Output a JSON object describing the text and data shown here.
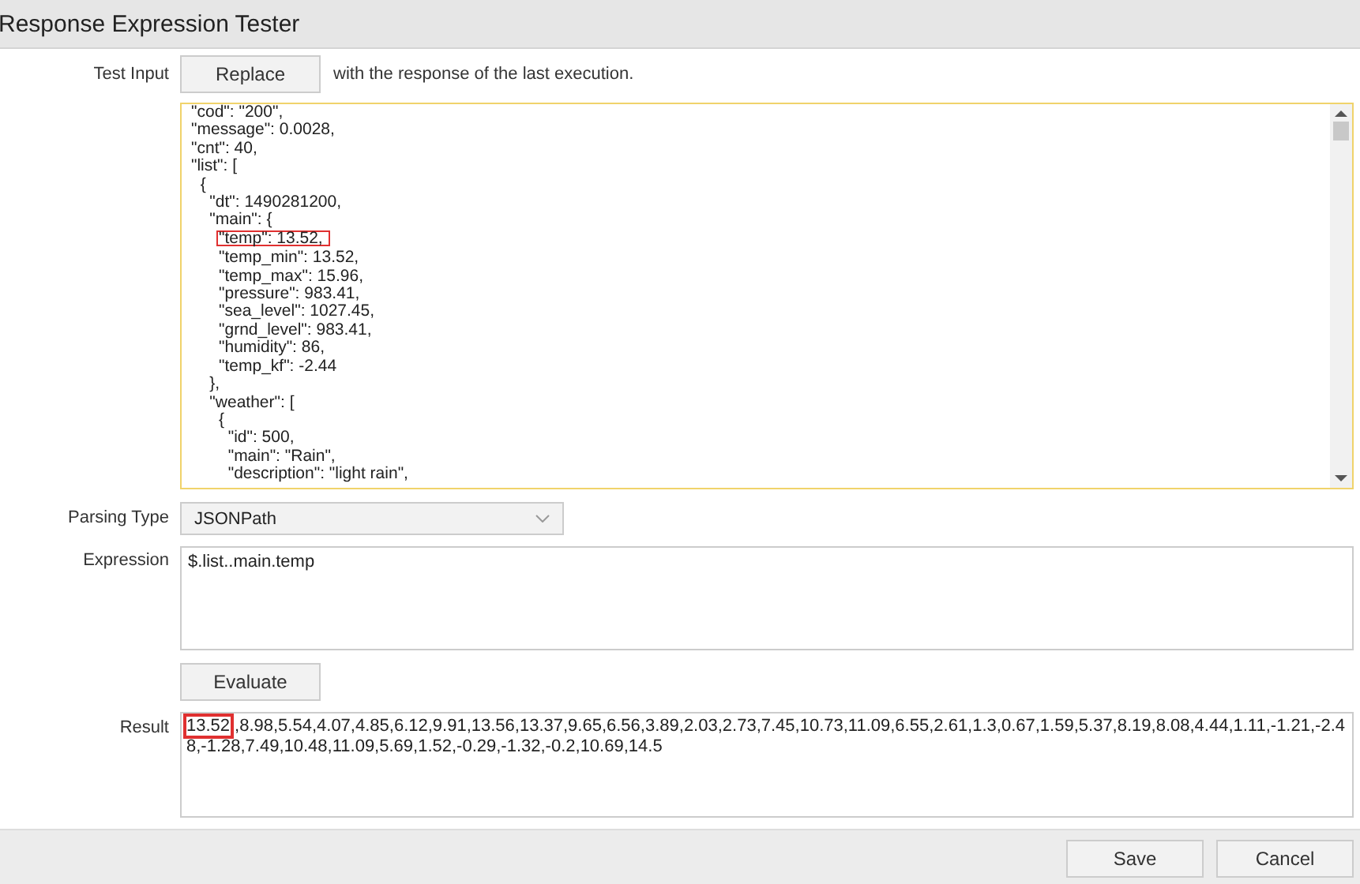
{
  "window": {
    "title": "Response Expression Tester"
  },
  "test_input": {
    "label": "Test Input",
    "button": "Replace",
    "hint": "with the response of the last execution.",
    "lines": [
      {
        "text": "\"cod\": \"200\",",
        "boxed": false
      },
      {
        "text": "\"message\": 0.0028,",
        "boxed": false
      },
      {
        "text": "\"cnt\": 40,",
        "boxed": false
      },
      {
        "text": "\"list\": [",
        "boxed": false
      },
      {
        "text": "  {",
        "boxed": false
      },
      {
        "text": "    \"dt\": 1490281200,",
        "boxed": false
      },
      {
        "text": "    \"main\": {",
        "boxed": false
      },
      {
        "text": "      \"temp\": 13.52,",
        "boxed": true
      },
      {
        "text": "      \"temp_min\": 13.52,",
        "boxed": false
      },
      {
        "text": "      \"temp_max\": 15.96,",
        "boxed": false
      },
      {
        "text": "      \"pressure\": 983.41,",
        "boxed": false
      },
      {
        "text": "      \"sea_level\": 1027.45,",
        "boxed": false
      },
      {
        "text": "      \"grnd_level\": 983.41,",
        "boxed": false
      },
      {
        "text": "      \"humidity\": 86,",
        "boxed": false
      },
      {
        "text": "      \"temp_kf\": -2.44",
        "boxed": false
      },
      {
        "text": "    },",
        "boxed": false
      },
      {
        "text": "    \"weather\": [",
        "boxed": false
      },
      {
        "text": "      {",
        "boxed": false
      },
      {
        "text": "        \"id\": 500,",
        "boxed": false
      },
      {
        "text": "        \"main\": \"Rain\",",
        "boxed": false
      },
      {
        "text": "        \"description\": \"light rain\",",
        "boxed": false
      }
    ]
  },
  "parsing_type": {
    "label": "Parsing Type",
    "value": "JSONPath"
  },
  "expression": {
    "label": "Expression",
    "value": "$.list..main.temp"
  },
  "evaluate_button": "Evaluate",
  "result": {
    "label": "Result",
    "highlighted": "13.52",
    "rest": ",8.98,5.54,4.07,4.85,6.12,9.91,13.56,13.37,9.65,6.56,3.89,2.03,2.73,7.45,10.73,11.09,6.55,2.61,1.3,0.67,1.59,5.37,8.19,8.08,4.44,1.11,-1.21,-2.48,-1.28,7.49,10.48,11.09,5.69,1.52,-0.29,-1.32,-0.2,10.69,14.5"
  },
  "footer": {
    "buttons": [
      "Save",
      "Cancel"
    ]
  }
}
